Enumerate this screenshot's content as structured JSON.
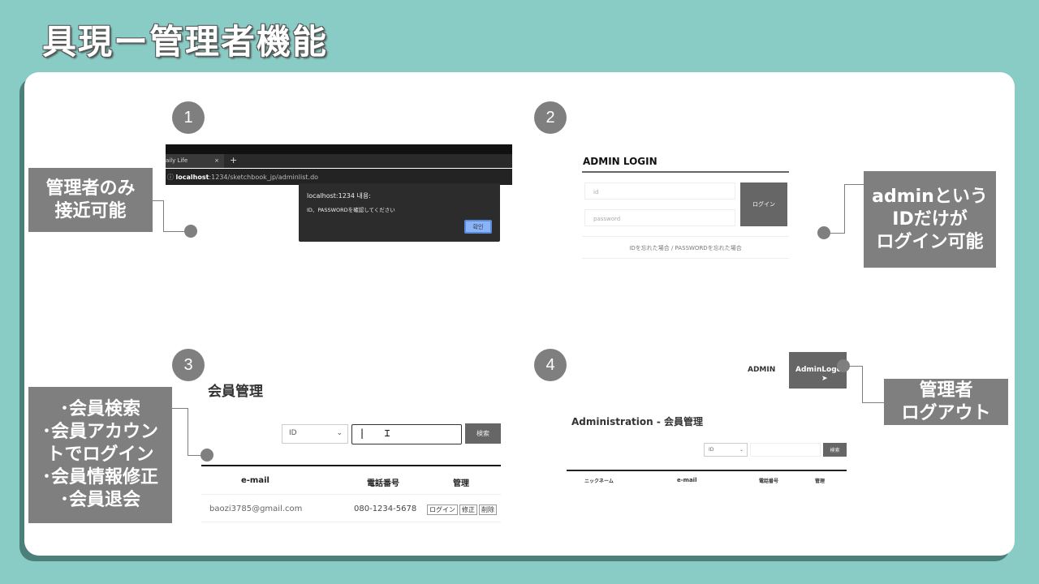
{
  "title": "具現ー管理者機能",
  "steps": [
    "1",
    "2",
    "3",
    "4"
  ],
  "labels": {
    "l1": [
      "管理者のみ",
      "接近可能"
    ],
    "l2": [
      "adminという",
      "IDだけが",
      "ログイン可能"
    ],
    "l3": [
      "･会員検索",
      "･会員アカウン",
      "トでログイン",
      "･会員情報修正",
      "･会員退会"
    ],
    "l4": [
      "管理者",
      "ログアウト"
    ]
  },
  "shot1": {
    "tab": "aily Life",
    "tab_close": "×",
    "new_tab": "+",
    "url_host": "localhost",
    "url_path": ":1234/sketchbook_jp/adminlist.do",
    "dialog_title": "localhost:1234 내용:",
    "dialog_msg": "ID、PASSWORDを確認してください",
    "ok": "확인"
  },
  "shot2": {
    "heading": "ADMIN LOGIN",
    "id_placeholder": "id",
    "pw_placeholder": "password",
    "login": "ログイン",
    "forgot": "IDを忘れた場合 / PASSWORDを忘れた場合"
  },
  "shot3": {
    "heading": "会員管理",
    "select": "ID",
    "search": "検索",
    "cols": [
      "e-mail",
      "電話番号",
      "管理"
    ],
    "row": {
      "email": "baozi3785@gmail.com",
      "phone": "080-1234-5678",
      "actions": [
        "ログイン",
        "修正",
        "削除"
      ]
    }
  },
  "shot4": {
    "admin": "ADMIN",
    "logout": "AdminLogout",
    "heading": "Administration - 会員管理",
    "select": "ID",
    "search": "検索",
    "cols": [
      "ニックネーム",
      "e-mail",
      "電話番号",
      "管理"
    ]
  }
}
